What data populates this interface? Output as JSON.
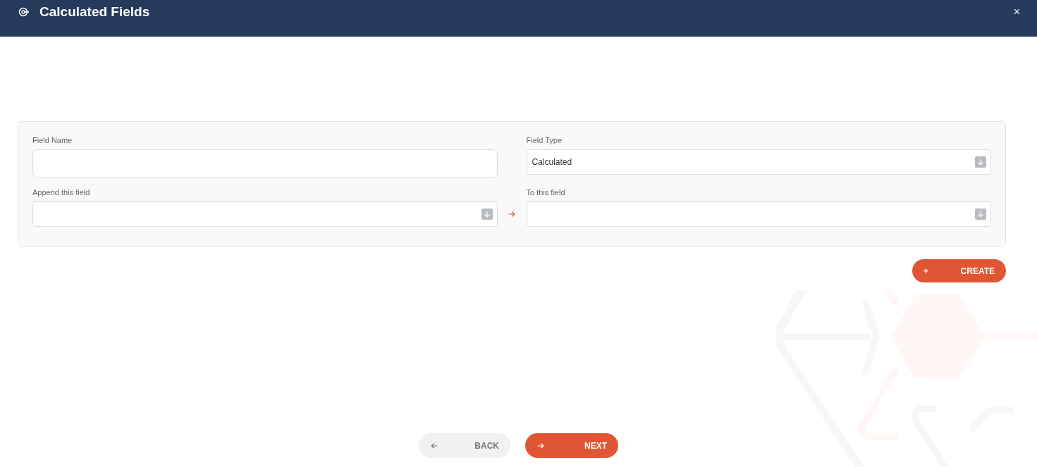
{
  "header": {
    "title": "Calculated Fields",
    "close": "×"
  },
  "fields": [
    {
      "label": "Field Name",
      "kind": "text"
    },
    {
      "label": "Field Type",
      "kind": "select",
      "value": "Calculated"
    },
    {
      "label": "Append this field",
      "kind": "select"
    },
    {
      "label": "To this field",
      "kind": "select"
    }
  ],
  "create_button": {
    "icon": "+",
    "label": "CREATE"
  },
  "footer_buttons": [
    {
      "label": "BACK",
      "kind": "secondary"
    },
    {
      "label": "NEXT",
      "kind": "primary"
    }
  ]
}
